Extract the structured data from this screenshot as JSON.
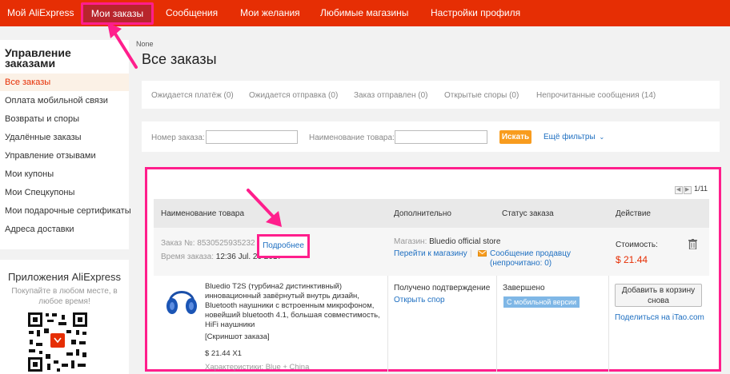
{
  "topnav": {
    "my_aliexpress": "Мой AliExpress",
    "my_orders": "Мои заказы",
    "messages": "Сообщения",
    "wishlist": "Мои желания",
    "fav_stores": "Любимые магазины",
    "profile_settings": "Настройки профиля"
  },
  "sidebar": {
    "title": "Управление заказами",
    "items": [
      "Все заказы",
      "Оплата мобильной связи",
      "Возвраты и споры",
      "Удалённые заказы",
      "Управление отзывами",
      "Мои купоны",
      "Мои Спецкупоны",
      "Мои подарочные сертификаты",
      "Адреса доставки"
    ]
  },
  "apps": {
    "title": "Приложения AliExpress",
    "subtitle": "Покупайте в любом месте, в любое время!"
  },
  "breadcrumb": "None",
  "page_title": "Все заказы",
  "status_tabs": [
    "Ожидается платёж (0)",
    "Ожидается отправка (0)",
    "Заказ отправлен (0)",
    "Открытые споры (0)",
    "Непрочитанные сообщения (14)"
  ],
  "filters": {
    "order_no_label": "Номер заказа:",
    "order_no_value": "",
    "product_name_label": "Наименование товара:",
    "product_name_value": "",
    "search_button": "Искать",
    "more_filters": "Ещё фильтры"
  },
  "pager": {
    "current": "1",
    "total": "11",
    "text": "1/11"
  },
  "table_headers": {
    "product": "Наименование товара",
    "additional": "Дополнительно",
    "status": "Статус заказа",
    "action": "Действие"
  },
  "order": {
    "order_no_label": "Заказ №:",
    "order_no": "8530525935232",
    "details_link": "Подробнее",
    "time_label": "Время заказа:",
    "time": "12:36 Jul. 20 2017",
    "store_label": "Магазин:",
    "store": "Bluedio official store",
    "go_to_store": "Перейти к магазину",
    "separator": "|",
    "message_seller": "Сообщение продавцу",
    "message_unread": "(непрочитано: 0)",
    "cost_label": "Стоимость:",
    "cost": "$ 21.44"
  },
  "item": {
    "title": "Bluedio T2S (турбина2 дистинктивный) инновационный завёрнутый внутрь дизайн, Bluetooth наушники с встроенным микрофоном, новейший bluetooth 4.1, большая совместимость, HiFi наушники",
    "snapshot": "[Скриншот заказа]",
    "price_qty": "$ 21.44 X1",
    "characteristics": "Характеристики: Blue + China",
    "confirm_status": "Получено подтверждение",
    "open_dispute": "Открыть спор",
    "status": "Завершено",
    "mobile_badge": "С мобильной версии",
    "add_to_cart": "Добавить в корзину снова",
    "share_prefix": "Поделиться на ",
    "share_site": "iTao.com"
  },
  "colors": {
    "brand_red": "#e62e04",
    "highlight_pink": "#ff1e8c",
    "link_blue": "#1e6fc1",
    "search_orange": "#f89c1e"
  },
  "icons": [
    "trash-icon",
    "envelope-icon",
    "chevron-down-icon",
    "headphones-image",
    "qr-code"
  ]
}
